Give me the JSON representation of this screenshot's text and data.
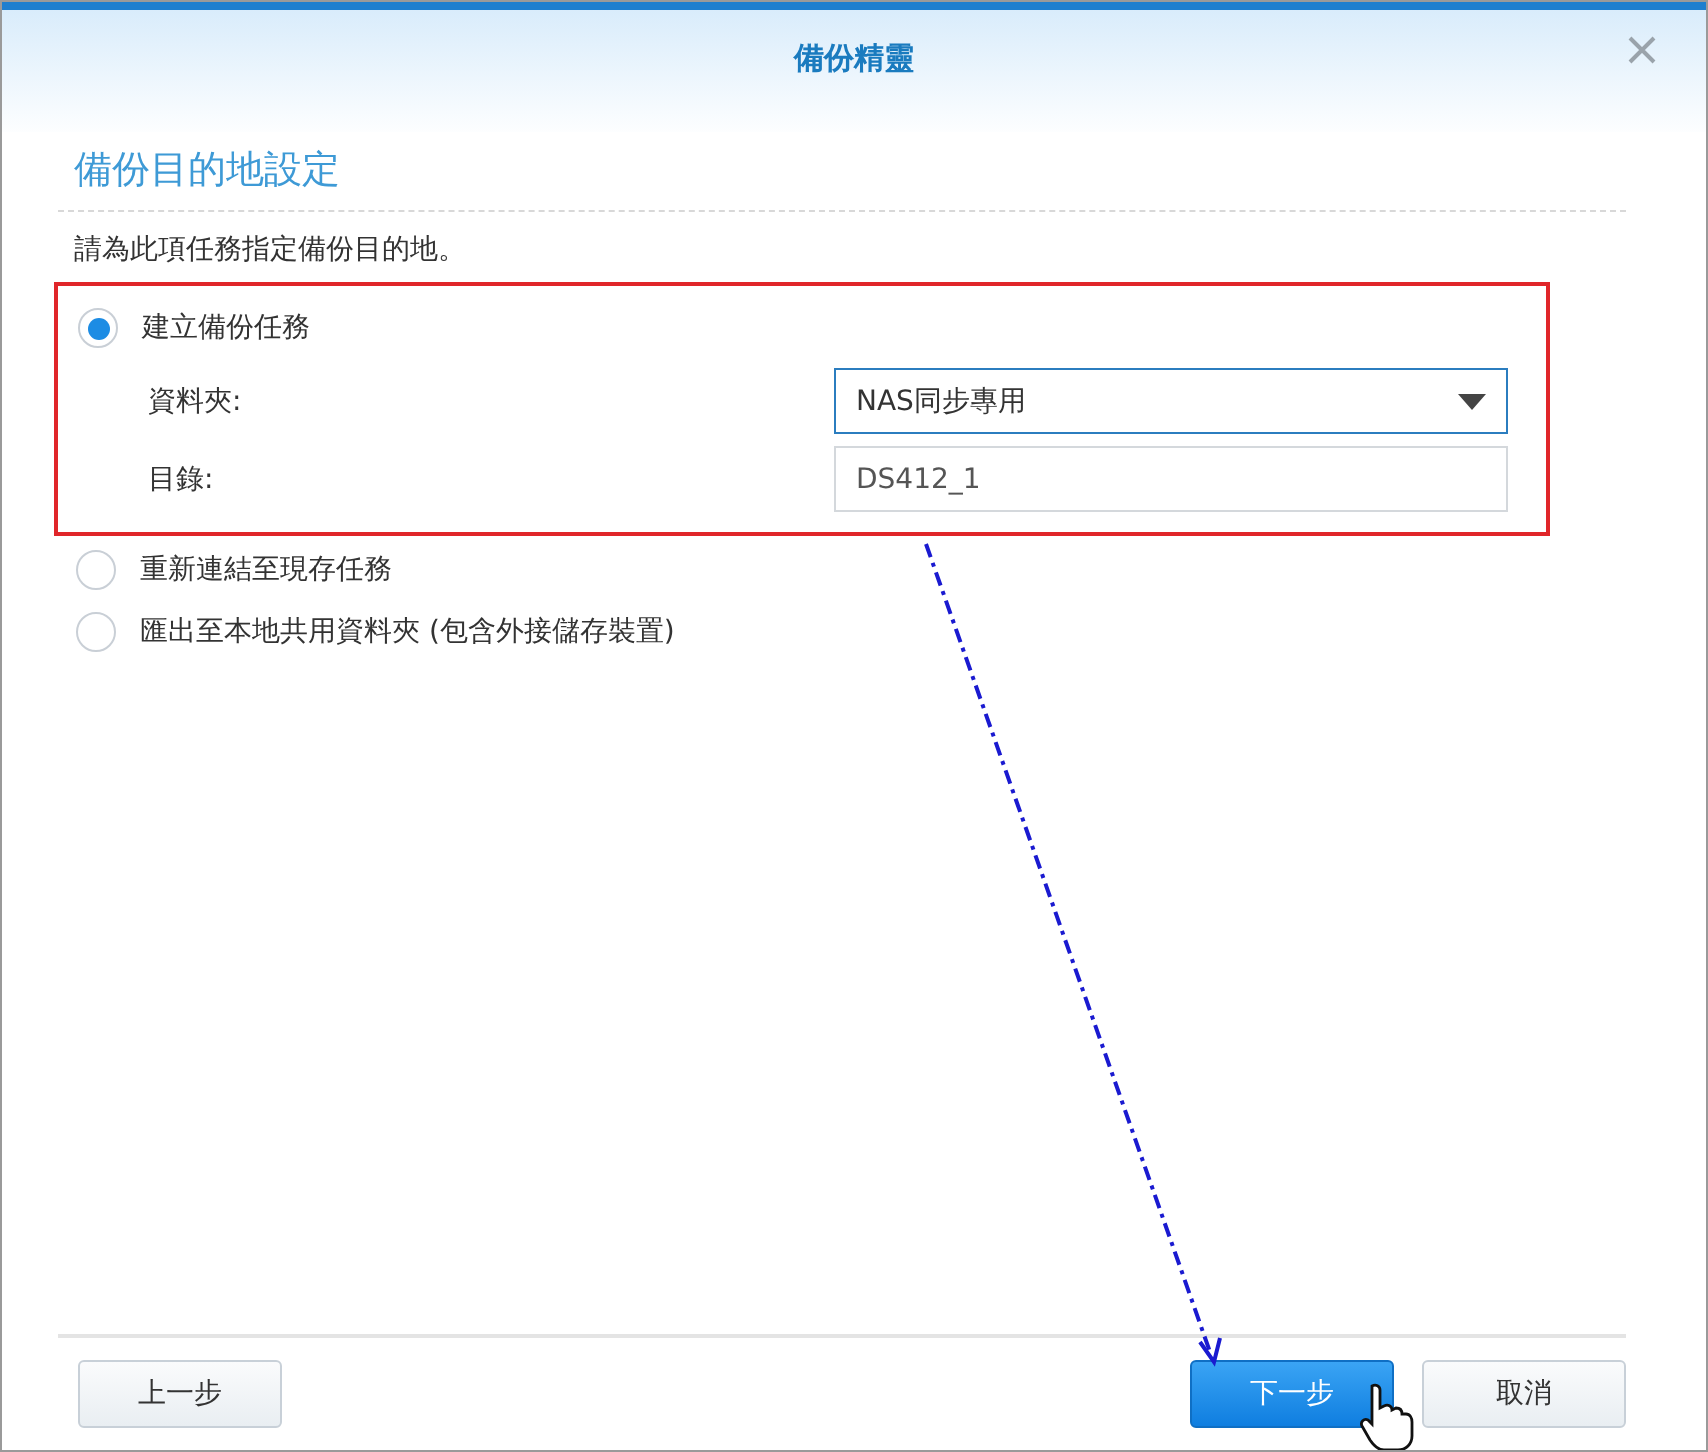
{
  "window": {
    "title": "備份精靈"
  },
  "section": {
    "title": "備份目的地設定",
    "description": "請為此項任務指定備份目的地。"
  },
  "options": [
    {
      "label": "建立備份任務",
      "selected": true,
      "highlighted": true,
      "fields": [
        {
          "kind": "select",
          "label": "資料夾:",
          "value": "NAS同步專用"
        },
        {
          "kind": "text",
          "label": "目錄:",
          "value": "DS412_1"
        }
      ]
    },
    {
      "label": "重新連結至現存任務",
      "selected": false,
      "highlighted": false
    },
    {
      "label": "匯出至本地共用資料夾 (包含外接儲存裝置)",
      "selected": false,
      "highlighted": false
    }
  ],
  "buttons": [
    {
      "label": "上一步",
      "kind": "secondary"
    },
    {
      "label": "下一步",
      "kind": "primary"
    },
    {
      "label": "取消",
      "kind": "secondary"
    }
  ]
}
